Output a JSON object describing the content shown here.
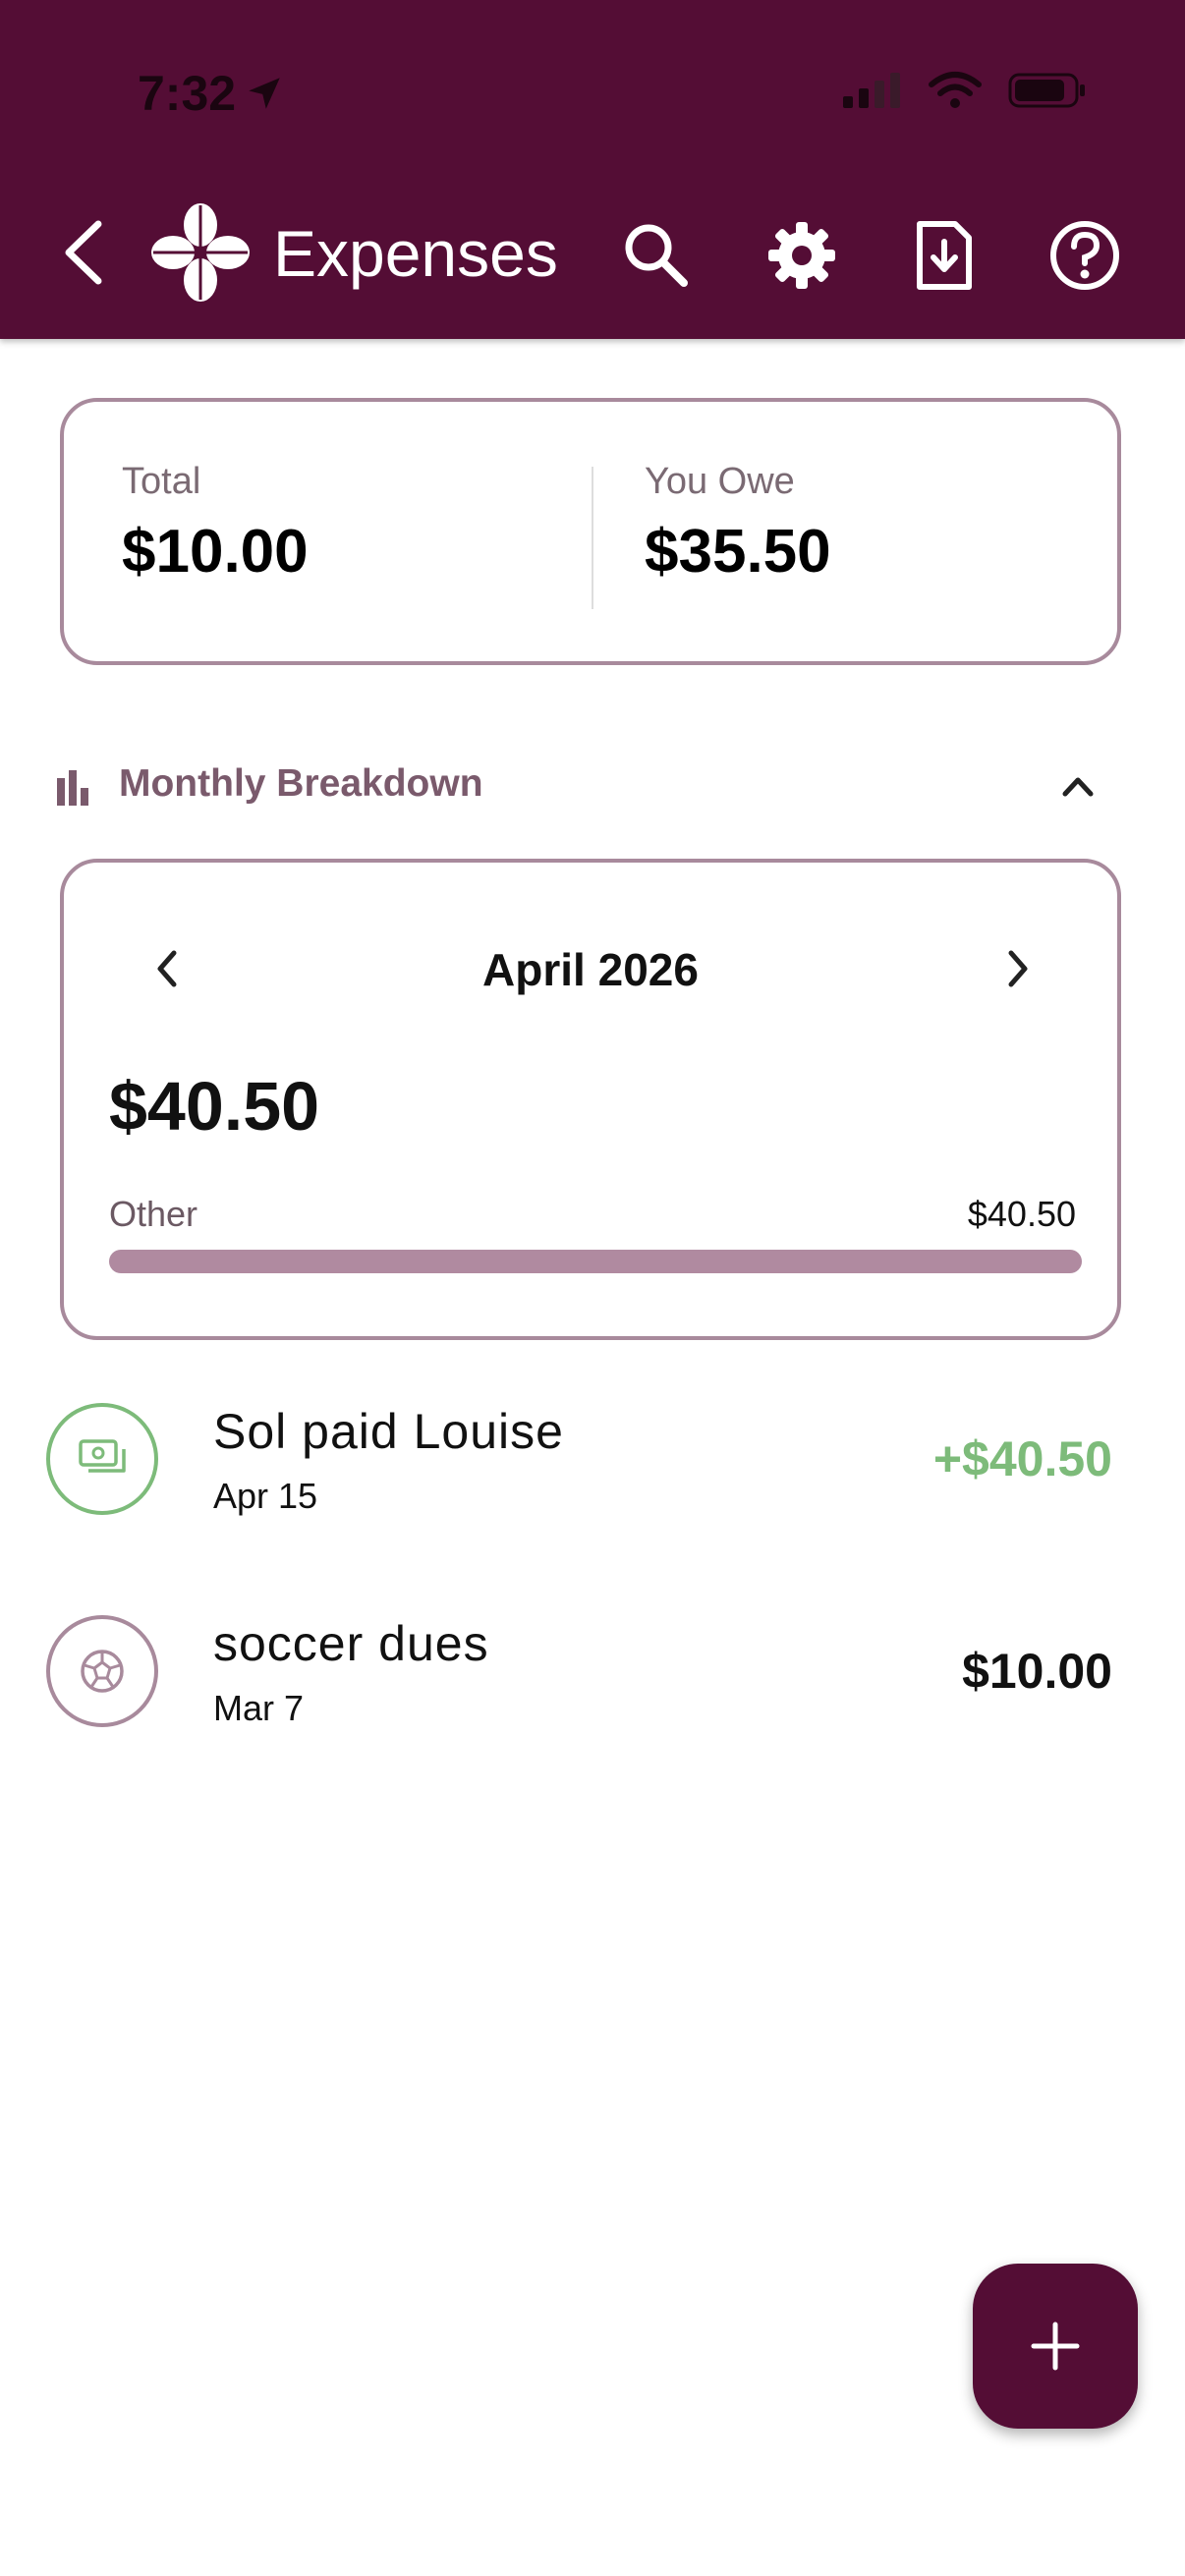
{
  "status_bar": {
    "time": "7:32",
    "icons": [
      "location-arrow-icon",
      "cellular-signal-icon",
      "wifi-icon",
      "battery-icon"
    ]
  },
  "header": {
    "title": "Expenses",
    "icons": [
      "back-icon",
      "clover-logo-icon",
      "search-icon",
      "gear-icon",
      "export-document-icon",
      "help-icon"
    ],
    "background_color": "#540d35"
  },
  "summary": {
    "total_label": "Total",
    "total_value": "$10.00",
    "owe_label": "You Owe",
    "owe_value": "$35.50"
  },
  "breakdown": {
    "label": "Monthly Breakdown",
    "month": "April 2026",
    "amount": "$40.50",
    "categories": [
      {
        "name": "Other",
        "amount": "$40.50",
        "fraction": 1.0
      }
    ]
  },
  "transactions": [
    {
      "title": "Sol paid Louise",
      "date": "Apr 15",
      "amount": "+$40.50",
      "icon": "money-icon",
      "color": "#7dbb7a"
    },
    {
      "title": "soccer dues",
      "date": "Mar 7",
      "amount": "$10.00",
      "icon": "soccer-ball-icon",
      "color": "#a88a9c"
    }
  ],
  "colors": {
    "accent": "#540d35",
    "card_border": "#a88a9c",
    "positive": "#7dbb7a",
    "bar": "#b08aa0"
  }
}
